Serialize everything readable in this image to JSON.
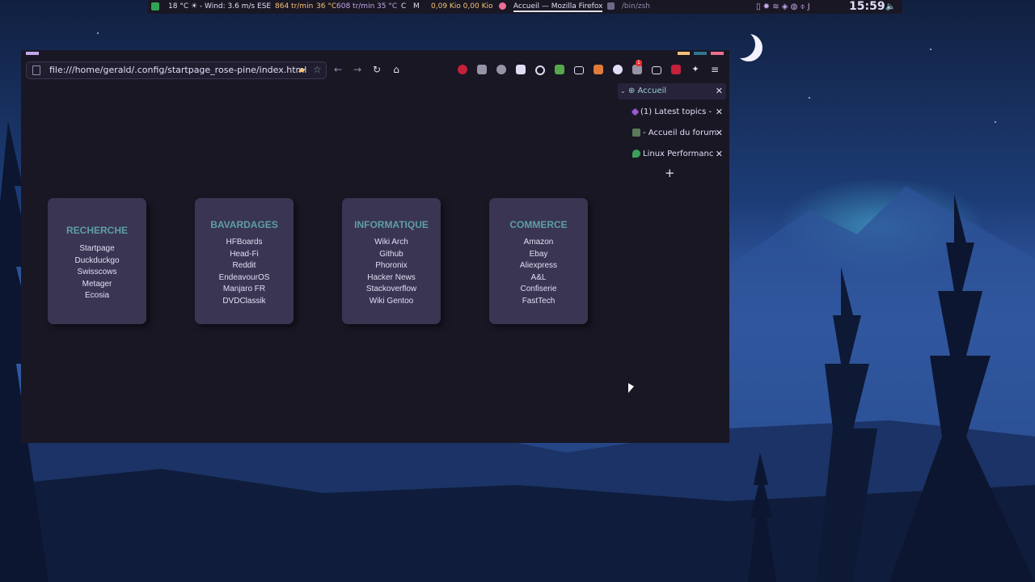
{
  "topbar": {
    "weather": "18 °C ☀ - Wind: 3.6 m/s ESE",
    "fan1": "864 tr/min",
    "temp1": "36 °C",
    "fan2": "608 tr/min",
    "temp2": "35 °C",
    "c_label": "C",
    "m_label": "M",
    "net": "0,09 Kio 0,00 Kio",
    "task_firefox": "Accueil — Mozilla Firefox",
    "task_terminal": "/bin/zsh",
    "clock": "15:59",
    "colors": {
      "accent": "#eb6f92",
      "bg": "#191724"
    }
  },
  "browser": {
    "url": "file:///home/gerald/.config/startpage_rose-pine/index.html",
    "icons": [
      "page-icon",
      "folder-icon",
      "star-icon",
      "back-icon",
      "forward-icon",
      "reload-icon",
      "home-icon",
      "extensions-icon",
      "menu-icon"
    ],
    "tab_badge": "1"
  },
  "sidebar": {
    "tabs": [
      {
        "label": "Accueil",
        "active": true
      },
      {
        "label": "(1) Latest topics -"
      },
      {
        "label": "- Accueil du forum"
      },
      {
        "label": "Linux Performance"
      }
    ],
    "new_tab": "+"
  },
  "startpage": {
    "cards": [
      {
        "title": "RECHERCHE",
        "links": [
          "Startpage",
          "Duckduckgo",
          "Swisscows",
          "Metager",
          "Ecosia"
        ]
      },
      {
        "title": "BAVARDAGES",
        "links": [
          "HFBoards",
          "Head-Fi",
          "Reddit",
          "EndeavourOS",
          "Manjaro FR",
          "DVDClassik"
        ]
      },
      {
        "title": "INFORMATIQUE",
        "links": [
          "Wiki Arch",
          "Github",
          "Phoronix",
          "Hacker News",
          "Stackoverflow",
          "Wiki Gentoo"
        ]
      },
      {
        "title": "COMMERCE",
        "links": [
          "Amazon",
          "Ebay",
          "Aliexpress",
          "A&L",
          "Confiserie",
          "FastTech"
        ]
      }
    ],
    "colors": {
      "card": "#393552",
      "title": "#5f9ea6",
      "bg": "#191724"
    }
  }
}
